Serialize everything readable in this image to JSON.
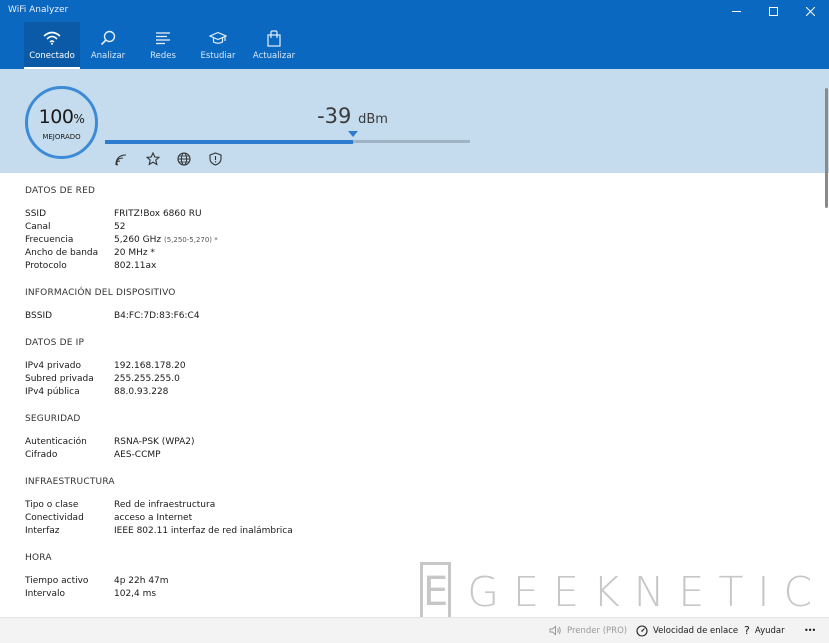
{
  "window": {
    "title": "WiFi Analyzer",
    "controls": [
      "minimize",
      "maximize",
      "close"
    ]
  },
  "nav": {
    "tabs": [
      {
        "label": "Conectado",
        "icon": "wifi-icon",
        "active": true
      },
      {
        "label": "Analizar",
        "icon": "search-icon",
        "active": false
      },
      {
        "label": "Redes",
        "icon": "list-icon",
        "active": false
      },
      {
        "label": "Estudiar",
        "icon": "graduation-cap-icon",
        "active": false
      },
      {
        "label": "Actualizar",
        "icon": "shopping-bag-icon",
        "active": false
      }
    ]
  },
  "signal": {
    "percent": "100",
    "percent_unit": "%",
    "quality": "MEJORADO",
    "dbm_value": "-39",
    "dbm_unit": "dBm",
    "strength_fraction": 0.68,
    "actions": [
      "signal-icon",
      "star-icon",
      "globe-icon",
      "shield-icon"
    ]
  },
  "details": {
    "network": {
      "title": "DATOS DE RED",
      "rows": [
        {
          "label": "SSID",
          "value": "FRITZ!Box 6860 RU"
        },
        {
          "label": "Canal",
          "value": "52"
        },
        {
          "label": "Frecuencia",
          "value": "5,260 GHz",
          "extra": "(5,250-5,270) *"
        },
        {
          "label": "Ancho de banda",
          "value": "20 MHz *"
        },
        {
          "label": "Protocolo",
          "value": "802.11ax"
        }
      ]
    },
    "device": {
      "title": "INFORMACIÓN DEL DISPOSITIVO",
      "rows": [
        {
          "label": "BSSID",
          "value": "B4:FC:7D:83:F6:C4"
        }
      ]
    },
    "ip": {
      "title": "DATOS DE IP",
      "rows": [
        {
          "label": "IPv4 privado",
          "value": "192.168.178.20"
        },
        {
          "label": "Subred privada",
          "value": "255.255.255.0"
        },
        {
          "label": "IPv4 pública",
          "value": "88.0.93.228"
        }
      ]
    },
    "security": {
      "title": "SEGURIDAD",
      "rows": [
        {
          "label": "Autenticación",
          "value": "RSNA-PSK (WPA2)"
        },
        {
          "label": "Cifrado",
          "value": "AES-CCMP"
        }
      ]
    },
    "infrastructure": {
      "title": "INFRAESTRUCTURA",
      "rows": [
        {
          "label": "Tipo o clase",
          "value": "Red de infraestructura"
        },
        {
          "label": "Conectividad",
          "value": "acceso a Internet"
        },
        {
          "label": "Interfaz",
          "value": "IEEE 802.11 interfaz de red inalámbrica"
        }
      ]
    },
    "time": {
      "title": "HORA",
      "rows": [
        {
          "label": "Tiempo activo",
          "value": "4p 22h 47m"
        },
        {
          "label": "Intervalo",
          "value": "102,4 ms"
        }
      ]
    }
  },
  "watermark": {
    "letter": "E",
    "text": "GEEKNETIC"
  },
  "statusbar": {
    "speaker": "Prender (PRO)",
    "link_speed": "Velocidad de enlace",
    "help": "Ayudar",
    "more": "•••"
  },
  "colors": {
    "brand": "#0a68c0",
    "panel": "#c4dced",
    "accent": "#2d7cd0"
  }
}
